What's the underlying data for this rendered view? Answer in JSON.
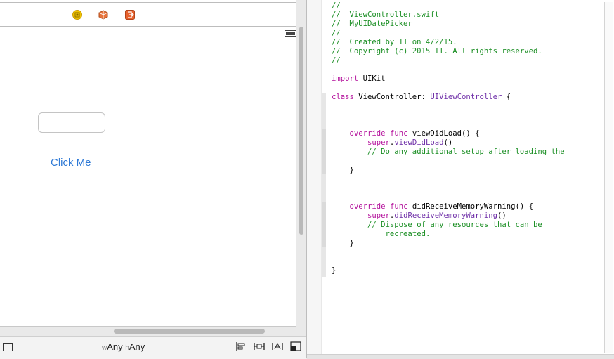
{
  "scene": {
    "button_label": "Click Me",
    "text_field_value": ""
  },
  "bottom_bar": {
    "width_prefix": "w",
    "width_value": "Any",
    "height_prefix": "h",
    "height_value": "Any"
  },
  "icons": {
    "dock": [
      "view-controller-icon",
      "first-responder-icon",
      "exit-icon"
    ],
    "layout": [
      "align-icon",
      "pin-icon",
      "resolve-auto-layout-icon",
      "resizing-behavior-icon"
    ]
  },
  "colors": {
    "comment": "#1c8f25",
    "keyword": "#b4129c",
    "type": "#6f2fa8",
    "button_tint": "#2f7ad6"
  },
  "code": {
    "lines": [
      [
        {
          "c": "c",
          "t": "//"
        }
      ],
      [
        {
          "c": "c",
          "t": "//  ViewController.swift"
        }
      ],
      [
        {
          "c": "c",
          "t": "//  MyUIDatePicker"
        }
      ],
      [
        {
          "c": "c",
          "t": "//"
        }
      ],
      [
        {
          "c": "c",
          "t": "//  Created by IT on 4/2/15."
        }
      ],
      [
        {
          "c": "c",
          "t": "//  Copyright (c) 2015 IT. All rights reserved."
        }
      ],
      [
        {
          "c": "c",
          "t": "//"
        }
      ],
      [],
      [
        {
          "c": "k",
          "t": "import"
        },
        {
          "c": "x",
          "t": " UIKit"
        }
      ],
      [],
      [
        {
          "c": "k",
          "t": "class"
        },
        {
          "c": "x",
          "t": " ViewController: "
        },
        {
          "c": "t",
          "t": "UIViewController"
        },
        {
          "c": "x",
          "t": " {"
        }
      ],
      [],
      [],
      [],
      [
        {
          "c": "x",
          "t": "    "
        },
        {
          "c": "k",
          "t": "override"
        },
        {
          "c": "x",
          "t": " "
        },
        {
          "c": "k",
          "t": "func"
        },
        {
          "c": "x",
          "t": " viewDidLoad() {"
        }
      ],
      [
        {
          "c": "x",
          "t": "        "
        },
        {
          "c": "k",
          "t": "super"
        },
        {
          "c": "x",
          "t": "."
        },
        {
          "c": "t",
          "t": "viewDidLoad"
        },
        {
          "c": "x",
          "t": "()"
        }
      ],
      [
        {
          "c": "x",
          "t": "        "
        },
        {
          "c": "c",
          "t": "// Do any additional setup after loading the"
        }
      ],
      [],
      [
        {
          "c": "x",
          "t": "    }"
        }
      ],
      [],
      [],
      [],
      [
        {
          "c": "x",
          "t": "    "
        },
        {
          "c": "k",
          "t": "override"
        },
        {
          "c": "x",
          "t": " "
        },
        {
          "c": "k",
          "t": "func"
        },
        {
          "c": "x",
          "t": " didReceiveMemoryWarning() {"
        }
      ],
      [
        {
          "c": "x",
          "t": "        "
        },
        {
          "c": "k",
          "t": "super"
        },
        {
          "c": "x",
          "t": "."
        },
        {
          "c": "t",
          "t": "didReceiveMemoryWarning"
        },
        {
          "c": "x",
          "t": "()"
        }
      ],
      [
        {
          "c": "x",
          "t": "        "
        },
        {
          "c": "c",
          "t": "// Dispose of any resources that can be"
        }
      ],
      [
        {
          "c": "x",
          "t": "            "
        },
        {
          "c": "c",
          "t": "recreated."
        }
      ],
      [
        {
          "c": "x",
          "t": "    }"
        }
      ],
      [],
      [],
      [
        {
          "c": "x",
          "t": "}"
        }
      ]
    ]
  }
}
